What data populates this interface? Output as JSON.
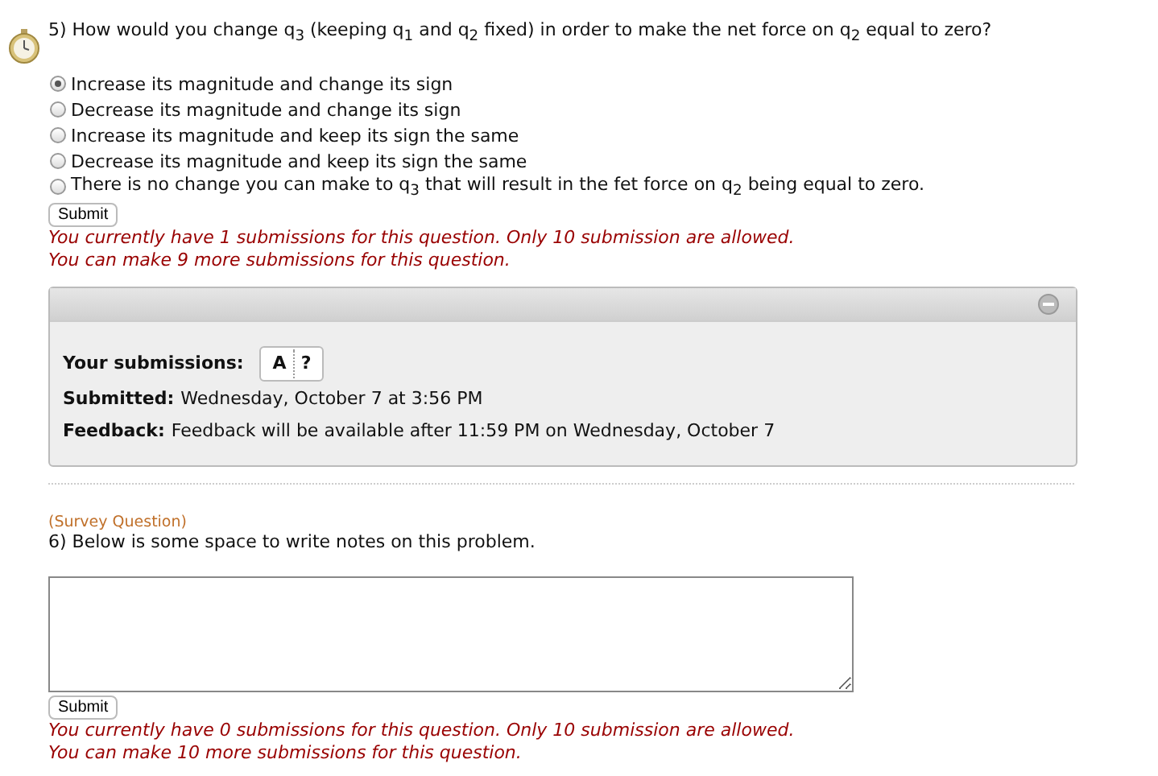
{
  "question5": {
    "text": "5) How would you change q$_{3}$ (keeping q$_{1}$ and q$_{2}$ fixed) in order to make the net force on q$_{2}$ equal to zero?",
    "options": [
      {
        "label": "Increase its magnitude and change its sign",
        "selected": true
      },
      {
        "label": "Decrease its magnitude and change its sign",
        "selected": false
      },
      {
        "label": "Increase its magnitude and keep its sign the same",
        "selected": false
      },
      {
        "label": "Decrease its magnitude and keep its sign the same",
        "selected": false
      },
      {
        "label": "There is no change you can make to q$_{3}$ that will result in the fet force on q$_{2}$ being equal to zero.",
        "selected": false
      }
    ],
    "submit": "Submit",
    "messages": [
      "You currently have 1 submissions for this question. Only 10 submission are allowed.",
      "You can make 9 more submissions for this question."
    ],
    "panel": {
      "submissions_label": "Your submissions:",
      "submissions": [
        "A",
        "?"
      ],
      "submitted_label": "Submitted:",
      "submitted": "Wednesday, October 7 at 3:56 PM",
      "feedback_label": "Feedback:",
      "feedback": "Feedback will be available after 11:59 PM on Wednesday, October 7"
    }
  },
  "question6": {
    "tag": "(Survey Question)",
    "text": "6) Below is some space to write notes on this problem.",
    "submit": "Submit",
    "messages": [
      "You currently have 0 submissions for this question. Only 10 submission are allowed.",
      "You can make 10 more submissions for this question."
    ]
  }
}
